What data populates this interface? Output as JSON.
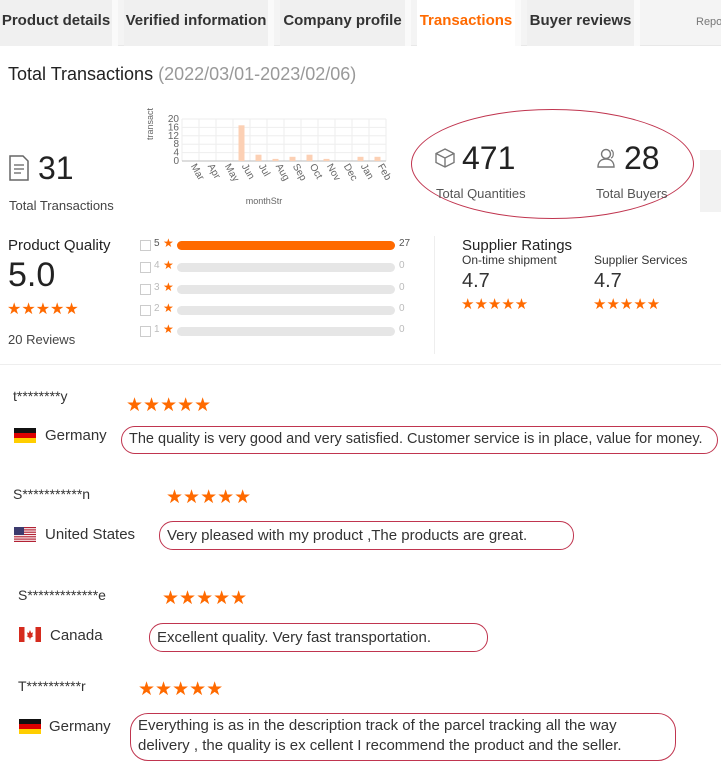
{
  "tabs": [
    {
      "label": "Product details"
    },
    {
      "label": "Verified information"
    },
    {
      "label": "Company profile"
    },
    {
      "label": "Transactions"
    },
    {
      "label": "Buyer reviews"
    },
    {
      "label": "Repo"
    }
  ],
  "active_tab": "Transactions",
  "accent_color": "#ff6a00",
  "highlight_color": "#c0354f",
  "header": {
    "title": "Total Transactions",
    "date_range": "(2022/03/01-2023/02/06)"
  },
  "chart_data": {
    "type": "bar",
    "xlabel": "monthStr",
    "ylabel": "transact",
    "categories": [
      "Mar",
      "Apr",
      "May",
      "Jun",
      "Jul",
      "Aug",
      "Sep",
      "Oct",
      "Nov",
      "Dec",
      "Jan",
      "Feb"
    ],
    "values": [
      0,
      0,
      0,
      17,
      3,
      1,
      2,
      3,
      1,
      0,
      2,
      2
    ],
    "ylim": [
      0,
      20
    ],
    "yticks": [
      "0",
      "4",
      "8",
      "12",
      "16",
      "20"
    ],
    "grid": true,
    "bar_color": "#fcd0b4"
  },
  "stats": {
    "transactions_value": "31",
    "transactions_label": "Total Transactions",
    "quantities_value": "471",
    "quantities_label": "Total Quantities",
    "buyers_value": "28",
    "buyers_label": "Total Buyers"
  },
  "product_quality": {
    "title": "Product Quality",
    "score": "5.0",
    "stars": "★★★★★",
    "reviews": "20 Reviews",
    "breakdown": [
      {
        "star": "5",
        "count": "27",
        "fraction": 1.0
      },
      {
        "star": "4",
        "count": "0",
        "fraction": 0
      },
      {
        "star": "3",
        "count": "0",
        "fraction": 0
      },
      {
        "star": "2",
        "count": "0",
        "fraction": 0
      },
      {
        "star": "1",
        "count": "0",
        "fraction": 0
      }
    ]
  },
  "supplier_ratings": {
    "title": "Supplier Ratings",
    "shipment_label": "On-time shipment",
    "shipment_score": "4.7",
    "services_label": "Supplier Services",
    "services_score": "4.7",
    "stars": "★★★★★"
  },
  "reviews": [
    {
      "name": "t********y",
      "country": "Germany",
      "flag": "germany",
      "stars": "★★★★★",
      "text": "The quality is very good and very satisfied. Customer service is in place, value for money."
    },
    {
      "name": "S***********n",
      "country": "United States",
      "flag": "usa",
      "stars": "★★★★★",
      "text": "Very pleased with my product ,The products are great."
    },
    {
      "name": "S*************e",
      "country": "Canada",
      "flag": "canada",
      "stars": "★★★★★",
      "text": "Excellent quality. Very fast transportation."
    },
    {
      "name": "T**********r",
      "country": "Germany",
      "flag": "germany",
      "stars": "★★★★★",
      "text_line1": "Everything is as in the description track of the parcel tracking all the way",
      "text_line2": "delivery , the quality is ex cellent I recommend the product and the seller."
    }
  ]
}
